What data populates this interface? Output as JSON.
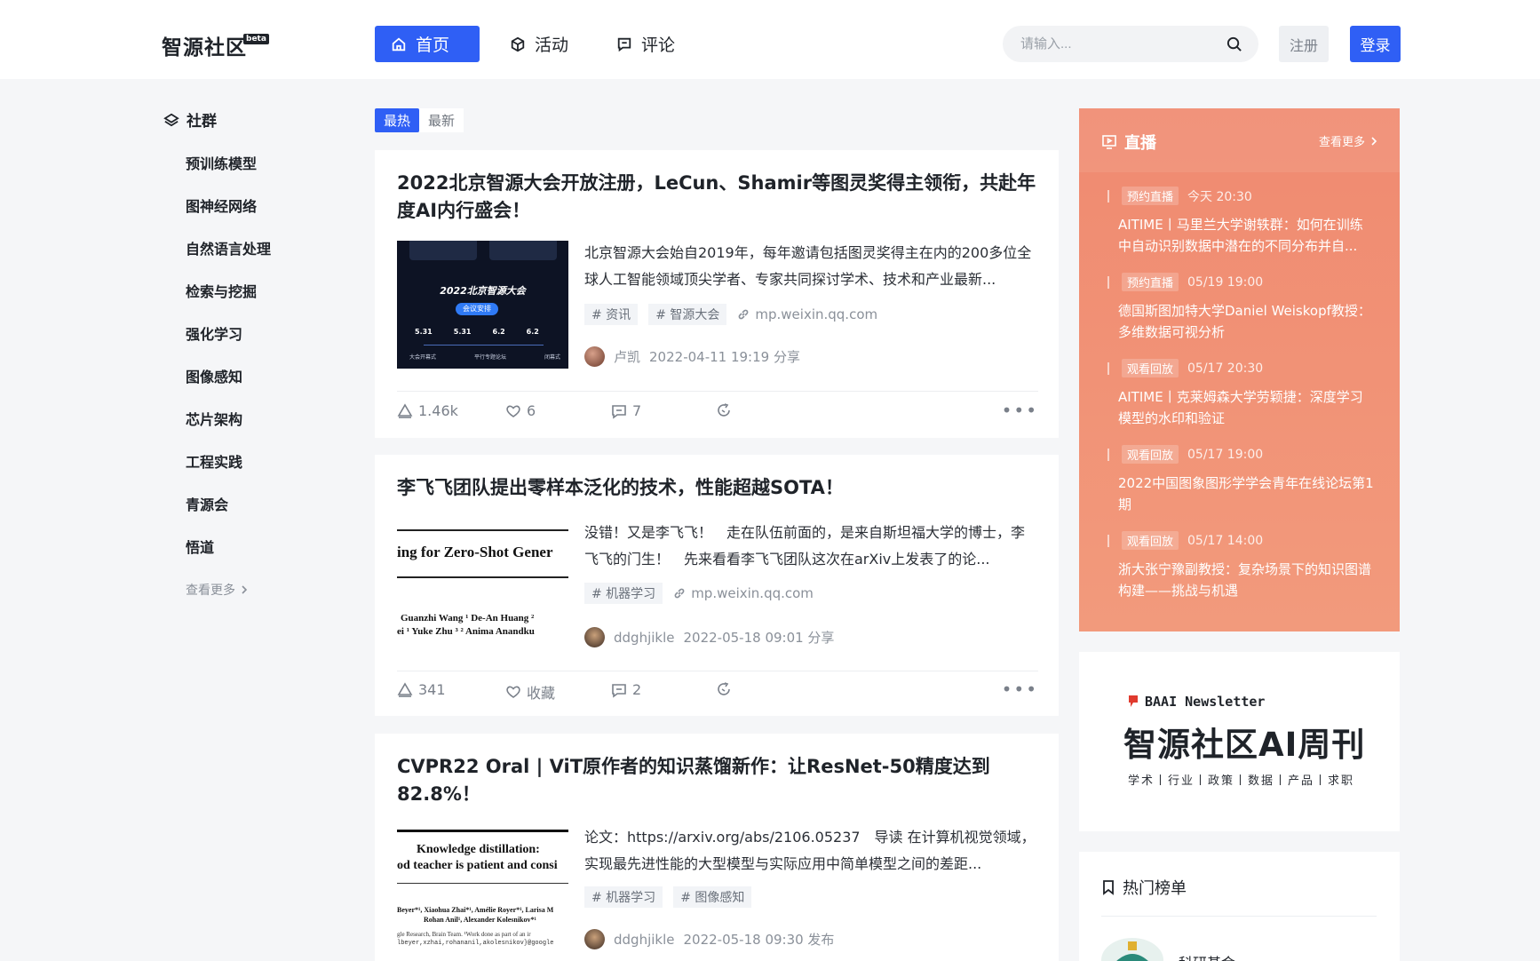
{
  "header": {
    "logo": "智源社区",
    "logo_badge": "beta",
    "nav": [
      {
        "label": "首页",
        "icon": "home-icon",
        "active": true
      },
      {
        "label": "活动",
        "icon": "cube-icon",
        "active": false
      },
      {
        "label": "评论",
        "icon": "comment-icon",
        "active": false
      }
    ],
    "search_placeholder": "请输入...",
    "register_label": "注册",
    "login_label": "登录"
  },
  "sidebar": {
    "title": "社群",
    "items": [
      "预训练模型",
      "图神经网络",
      "自然语言处理",
      "检索与挖掘",
      "强化学习",
      "图像感知",
      "芯片架构",
      "工程实践",
      "青源会",
      "悟道"
    ],
    "more_label": "查看更多"
  },
  "feed": {
    "tabs": [
      "最热",
      "最新"
    ],
    "posts": [
      {
        "title": "2022北京智源大会开放注册，LeCun、Shamir等图灵奖得主领衔，共赴年度AI内行盛会！",
        "summary": "北京智源大会始自2019年，每年邀请包括图灵奖得主在内的200多位全球人工智能领域顶尖学者、专家共同探讨学术、技术和产业最新...",
        "tags": [
          "# 资讯",
          "# 智源大会"
        ],
        "link": "mp.weixin.qq.com",
        "author": "卢凯",
        "time": "2022-04-11 19:19 分享",
        "thumb_text": {
          "title": "2022北京智源大会",
          "pill": "会议安排",
          "dates": [
            "5.31",
            "5.31",
            "6.2",
            "6.2"
          ],
          "labels": [
            "大会开幕式",
            "平行专题论坛",
            "闭幕式"
          ]
        },
        "stats": {
          "likes": "1.46k",
          "favorites": "6",
          "comments": "7"
        }
      },
      {
        "title": "李飞飞团队提出零样本泛化的技术，性能超越SOTA！",
        "summary": "没错！又是李飞飞！　走在队伍前面的，是来自斯坦福大学的博士，李飞飞的门生！　先来看看李飞飞团队这次在arXiv上发表了的论...",
        "tags": [
          "# 机器学习"
        ],
        "link": "mp.weixin.qq.com",
        "author": "ddghjikle",
        "time": "2022-05-18 09:01 分享",
        "thumb_text": {
          "heading": "ing for Zero-Shot Gener",
          "authors1": "Guanzhi Wang ¹   De-An Huang ²",
          "authors2": "ei ¹  Yuke Zhu ³ ²   Anima Anandku"
        },
        "stats": {
          "likes": "341",
          "favorites": "收藏",
          "comments": "2"
        }
      },
      {
        "title": "CVPR22 Oral | ViT原作者的知识蒸馏新作：让ResNet-50精度达到82.8%！",
        "summary": "论文：https://arxiv.org/abs/2106.05237　导读 在计算机视觉领域，实现最先进性能的大型模型与实际应用中简单模型之间的差距...",
        "tags": [
          "# 机器学习",
          "# 图像感知"
        ],
        "author": "ddghjikle",
        "time": "2022-05-18 09:30 发布",
        "thumb_text": {
          "heading1": "Knowledge distillation:",
          "heading2": "od teacher is patient and consi",
          "authors1": "Beyer*¹, Xiaohua Zhai*¹, Amélie Royer*¹, Larisa M",
          "authors2": "Rohan Anil¹, Alexander Kolesnikov*¹",
          "affil1": "gle Research, Brain Team. ¹Work done as part of an ir",
          "affil2": "lbeyer,xzhai,rohananil,akolesnikov}@google"
        }
      }
    ]
  },
  "live": {
    "title": "直播",
    "more_label": "查看更多",
    "items": [
      {
        "badge": "预约直播",
        "time": "今天 20:30",
        "text": "AITIME丨马里兰大学谢轶群：如何在训练中自动识别数据中潜在的不同分布并自..."
      },
      {
        "badge": "预约直播",
        "time": "05/19 19:00",
        "text": "德国斯图加特大学Daniel Weiskopf教授：多维数据可视分析"
      },
      {
        "badge": "观看回放",
        "time": "05/17 20:30",
        "text": "AITIME丨克莱姆森大学劳颖捷：深度学习模型的水印和验证"
      },
      {
        "badge": "观看回放",
        "time": "05/17 19:00",
        "text": "2022中国图象图形学学会青年在线论坛第1期"
      },
      {
        "badge": "观看回放",
        "time": "05/17 14:00",
        "text": "浙大张宁豫副教授：复杂场景下的知识图谱构建——挑战与机遇"
      }
    ]
  },
  "newsletter": {
    "brand": "BAAI Newsletter",
    "title": "智源社区AI周刊",
    "subtitle": "学术丨行业丨政策丨数据丨产品丨求职"
  },
  "hot": {
    "title": "热门榜单",
    "first_item": "科研基金"
  },
  "colors": {
    "accent": "#2f5ff5",
    "live_panel": "#f08a70",
    "background": "#f5f6f8"
  }
}
